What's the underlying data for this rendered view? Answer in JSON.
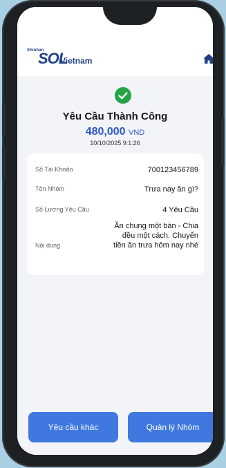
{
  "header": {
    "logo_brand": "Shinhan",
    "logo_product": "SOL",
    "logo_country": "Vietnam",
    "home_icon": "home-icon"
  },
  "result": {
    "status_icon": "check-circle-icon",
    "title": "Yêu Cầu Thành Công",
    "amount": "480,000",
    "currency": "VND",
    "datetime": "10/10/2025 9:1:26"
  },
  "details": [
    {
      "label": "Số Tài Khoản",
      "value": "700123456789"
    },
    {
      "label": "Tên Nhóm",
      "value": "Trưa nay ăn gì?"
    },
    {
      "label": "Số Lượng Yêu Cầu",
      "value": "4 Yêu Cầu"
    },
    {
      "label": "Nội dung",
      "value": "Ăn chung một bàn - Chia đều một cách. Chuyển tiền ăn trưa hôm nay nhé"
    }
  ],
  "actions": {
    "other_request": "Yêu cầu khác",
    "manage_group": "Quản lý Nhóm"
  },
  "colors": {
    "accent": "#3f78df",
    "amount": "#2c59c6",
    "success": "#22a447",
    "brand": "#1f3f86",
    "background": "#a9cfe2"
  }
}
